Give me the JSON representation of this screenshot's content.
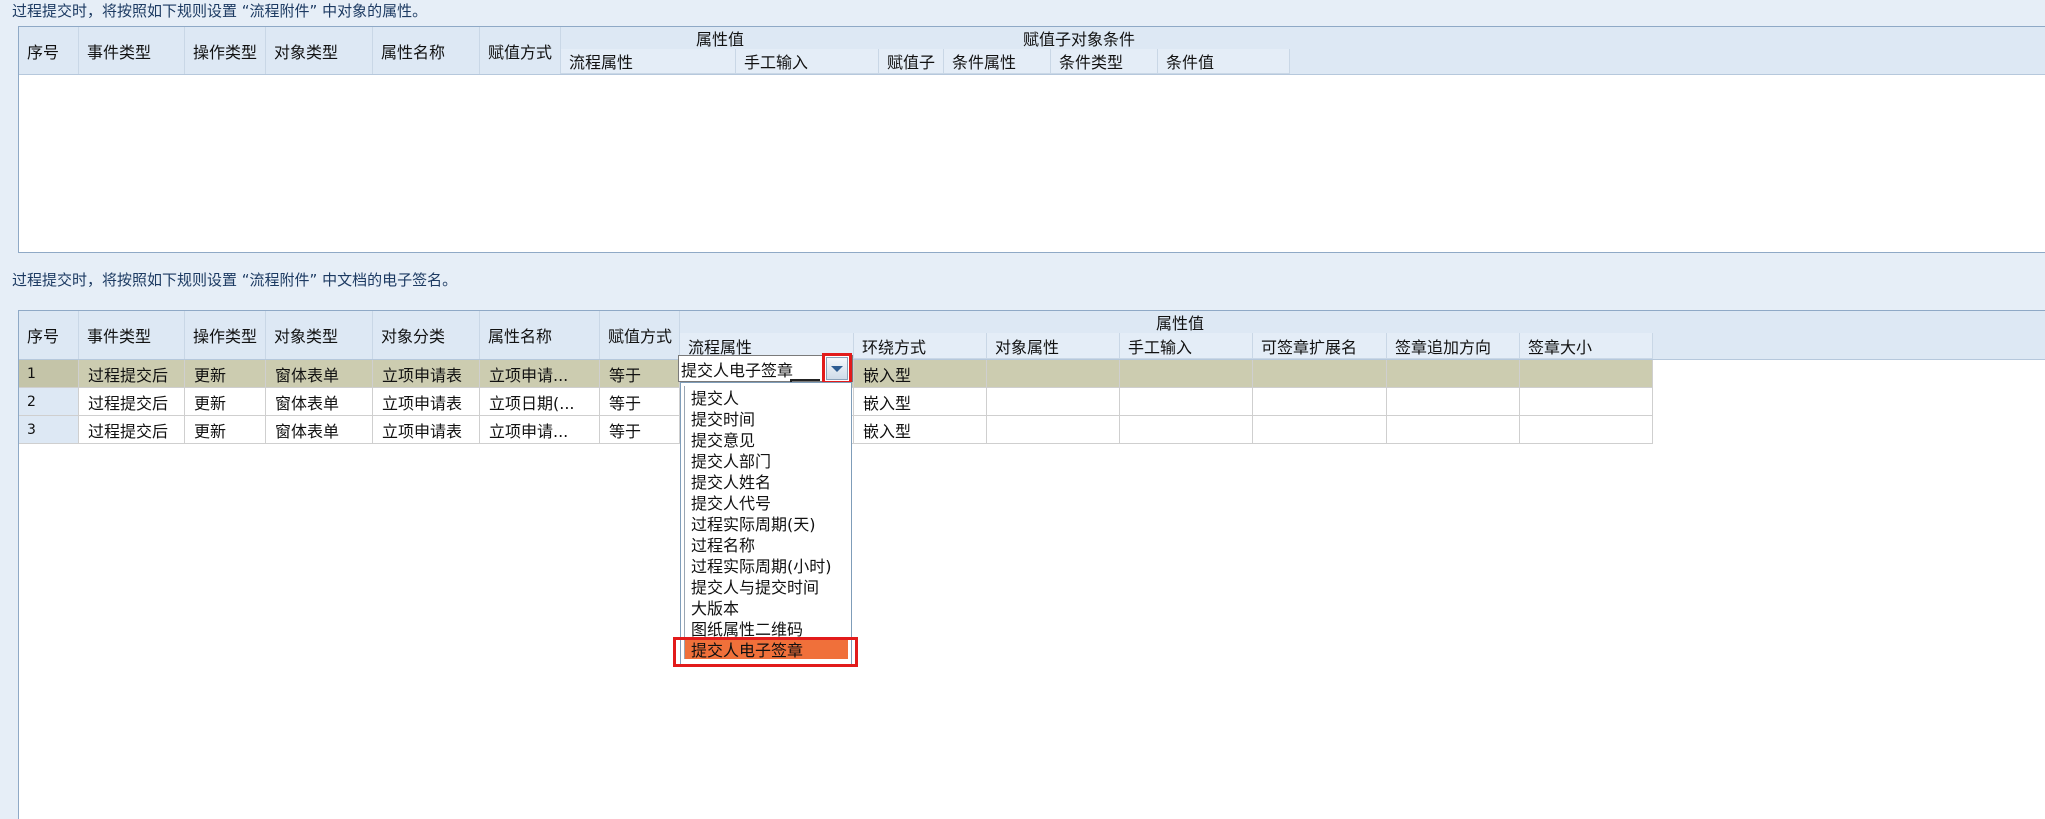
{
  "section1": {
    "note": "过程提交时，将按照如下规则设置 “流程附件” 中对象的属性。",
    "columns": {
      "seq": "序号",
      "event_type": "事件类型",
      "op_type": "操作类型",
      "obj_type": "对象类型",
      "attr_name": "属性名称",
      "assign_mode": "赋值方式",
      "group_attr_value": "属性值",
      "flow_attr": "流程属性",
      "manual_input": "手工输入",
      "group_child_cond": "赋值子对象条件",
      "assign_child": "赋值子",
      "cond_attr": "条件属性",
      "cond_type": "条件类型",
      "cond_value": "条件值"
    }
  },
  "section2": {
    "note": "过程提交时，将按照如下规则设置 “流程附件” 中文档的电子签名。",
    "columns": {
      "seq": "序号",
      "event_type": "事件类型",
      "op_type": "操作类型",
      "obj_type": "对象类型",
      "obj_category": "对象分类",
      "attr_name": "属性名称",
      "assign_mode": "赋值方式",
      "group_attr_value": "属性值",
      "flow_attr": "流程属性",
      "wrap_mode": "环绕方式",
      "obj_attr": "对象属性",
      "manual_input": "手工输入",
      "sign_ext": "可签章扩展名",
      "sign_dir": "签章追加方向",
      "sign_size": "签章大小"
    },
    "rows": [
      {
        "seq": "1",
        "event_type": "过程提交后",
        "op_type": "更新",
        "obj_type": "窗体表单",
        "obj_category": "立项申请表",
        "attr_name": "立项申请...",
        "assign_mode": "等于",
        "flow_attr": "",
        "wrap_mode": "嵌入型"
      },
      {
        "seq": "2",
        "event_type": "过程提交后",
        "op_type": "更新",
        "obj_type": "窗体表单",
        "obj_category": "立项申请表",
        "attr_name": "立项日期(...",
        "assign_mode": "等于",
        "flow_attr": "",
        "wrap_mode": "嵌入型"
      },
      {
        "seq": "3",
        "event_type": "过程提交后",
        "op_type": "更新",
        "obj_type": "窗体表单",
        "obj_category": "立项申请表",
        "attr_name": "立项申请...",
        "assign_mode": "等于",
        "flow_attr": "",
        "wrap_mode": "嵌入型"
      }
    ],
    "editor_value": "提交人电子签章",
    "dropdown_options": [
      "提交人",
      "提交时间",
      "提交意见",
      "提交人部门",
      "提交人姓名",
      "提交人代号",
      "过程实际周期(天)",
      "过程名称",
      "过程实际周期(小时)",
      "提交人与提交时间",
      "大版本",
      "图纸属性二维码",
      "提交人电子签章"
    ],
    "dropdown_selected": "提交人电子签章"
  },
  "colors": {
    "highlight": "#f0703a",
    "callout_red": "#e21b1b",
    "selected_row": "#ccccb0",
    "header_bg": "#dde8f4"
  },
  "icons": [
    "dropdown-arrow-icon"
  ]
}
